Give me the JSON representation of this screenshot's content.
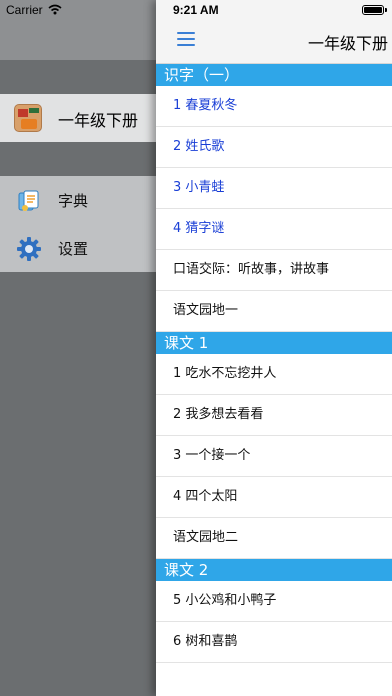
{
  "status": {
    "carrier": "Carrier",
    "time": "9:21 AM"
  },
  "sidebar": {
    "book_label": "一年级下册",
    "menu": [
      {
        "label": "字典",
        "icon": "dictionary-icon"
      },
      {
        "label": "设置",
        "icon": "gear-icon"
      }
    ]
  },
  "header": {
    "title": "一年级下册",
    "menu_icon": "hamburger-menu-icon"
  },
  "sections": [
    {
      "title": "识字（一）",
      "items": [
        {
          "label": "1 春夏秋冬",
          "highlight": true
        },
        {
          "label": "2 姓氏歌",
          "highlight": true
        },
        {
          "label": "3 小青蛙",
          "highlight": true
        },
        {
          "label": "4 猜字谜",
          "highlight": true
        },
        {
          "label": "口语交际：听故事，讲故事",
          "highlight": false
        },
        {
          "label": "语文园地一",
          "highlight": false
        }
      ]
    },
    {
      "title": "课文 1",
      "items": [
        {
          "label": "1 吃水不忘挖井人",
          "highlight": false
        },
        {
          "label": "2 我多想去看看",
          "highlight": false
        },
        {
          "label": "3 一个接一个",
          "highlight": false
        },
        {
          "label": "4 四个太阳",
          "highlight": false
        },
        {
          "label": "语文园地二",
          "highlight": false
        }
      ]
    },
    {
      "title": "课文 2",
      "items": [
        {
          "label": "5 小公鸡和小鸭子",
          "highlight": false
        },
        {
          "label": "6 树和喜鹊",
          "highlight": false
        }
      ]
    }
  ],
  "colors": {
    "section_bg": "#2fa6e8",
    "highlight_text": "#1a3fd6",
    "accent": "#3a7fd5"
  }
}
